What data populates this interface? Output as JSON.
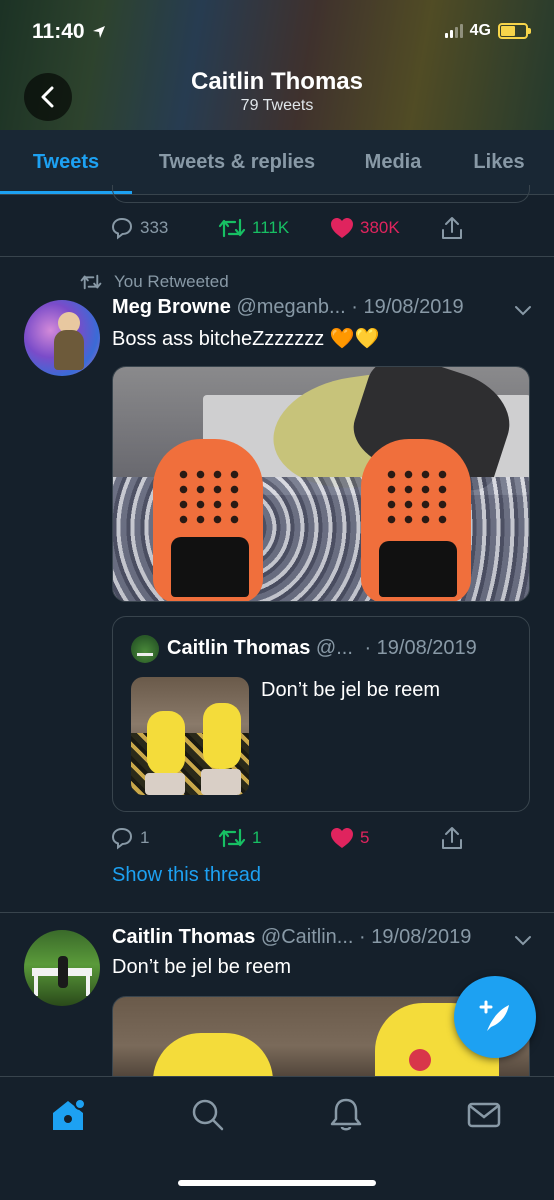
{
  "status_bar": {
    "time": "11:40",
    "network": "4G"
  },
  "header": {
    "title": "Caitlin Thomas",
    "subtitle": "79 Tweets"
  },
  "tabs": [
    {
      "label": "Tweets",
      "active": true
    },
    {
      "label": "Tweets & replies",
      "active": false
    },
    {
      "label": "Media",
      "active": false
    },
    {
      "label": "Likes",
      "active": false
    }
  ],
  "tweet0": {
    "replies": "333",
    "retweets": "111K",
    "likes": "380K"
  },
  "tweet1": {
    "retweet_label": "You Retweeted",
    "name": "Meg Browne",
    "handle": "@meganb...",
    "date": "· 19/08/2019",
    "text": "Boss ass bitcheZzzzzzz 🧡💛",
    "quote": {
      "name": "Caitlin Thomas",
      "handle": "@...",
      "date": "· 19/08/2019",
      "text": "Don’t be jel be reem"
    },
    "replies": "1",
    "retweets": "1",
    "likes": "5",
    "show_thread": "Show this thread"
  },
  "tweet2": {
    "name": "Caitlin Thomas",
    "handle": "@Caitlin...",
    "date": "· 19/08/2019",
    "text": "Don’t be jel be reem"
  },
  "colors": {
    "accent": "#1da1f2",
    "retweet": "#17bf63",
    "like": "#e0245e",
    "background": "#15202b",
    "muted": "#8899a6"
  },
  "icons": [
    "back-arrow-icon",
    "reply-icon",
    "retweet-icon",
    "heart-icon",
    "share-icon",
    "chevron-down-icon",
    "compose-icon",
    "home-icon",
    "search-icon",
    "bell-icon",
    "mail-icon"
  ]
}
